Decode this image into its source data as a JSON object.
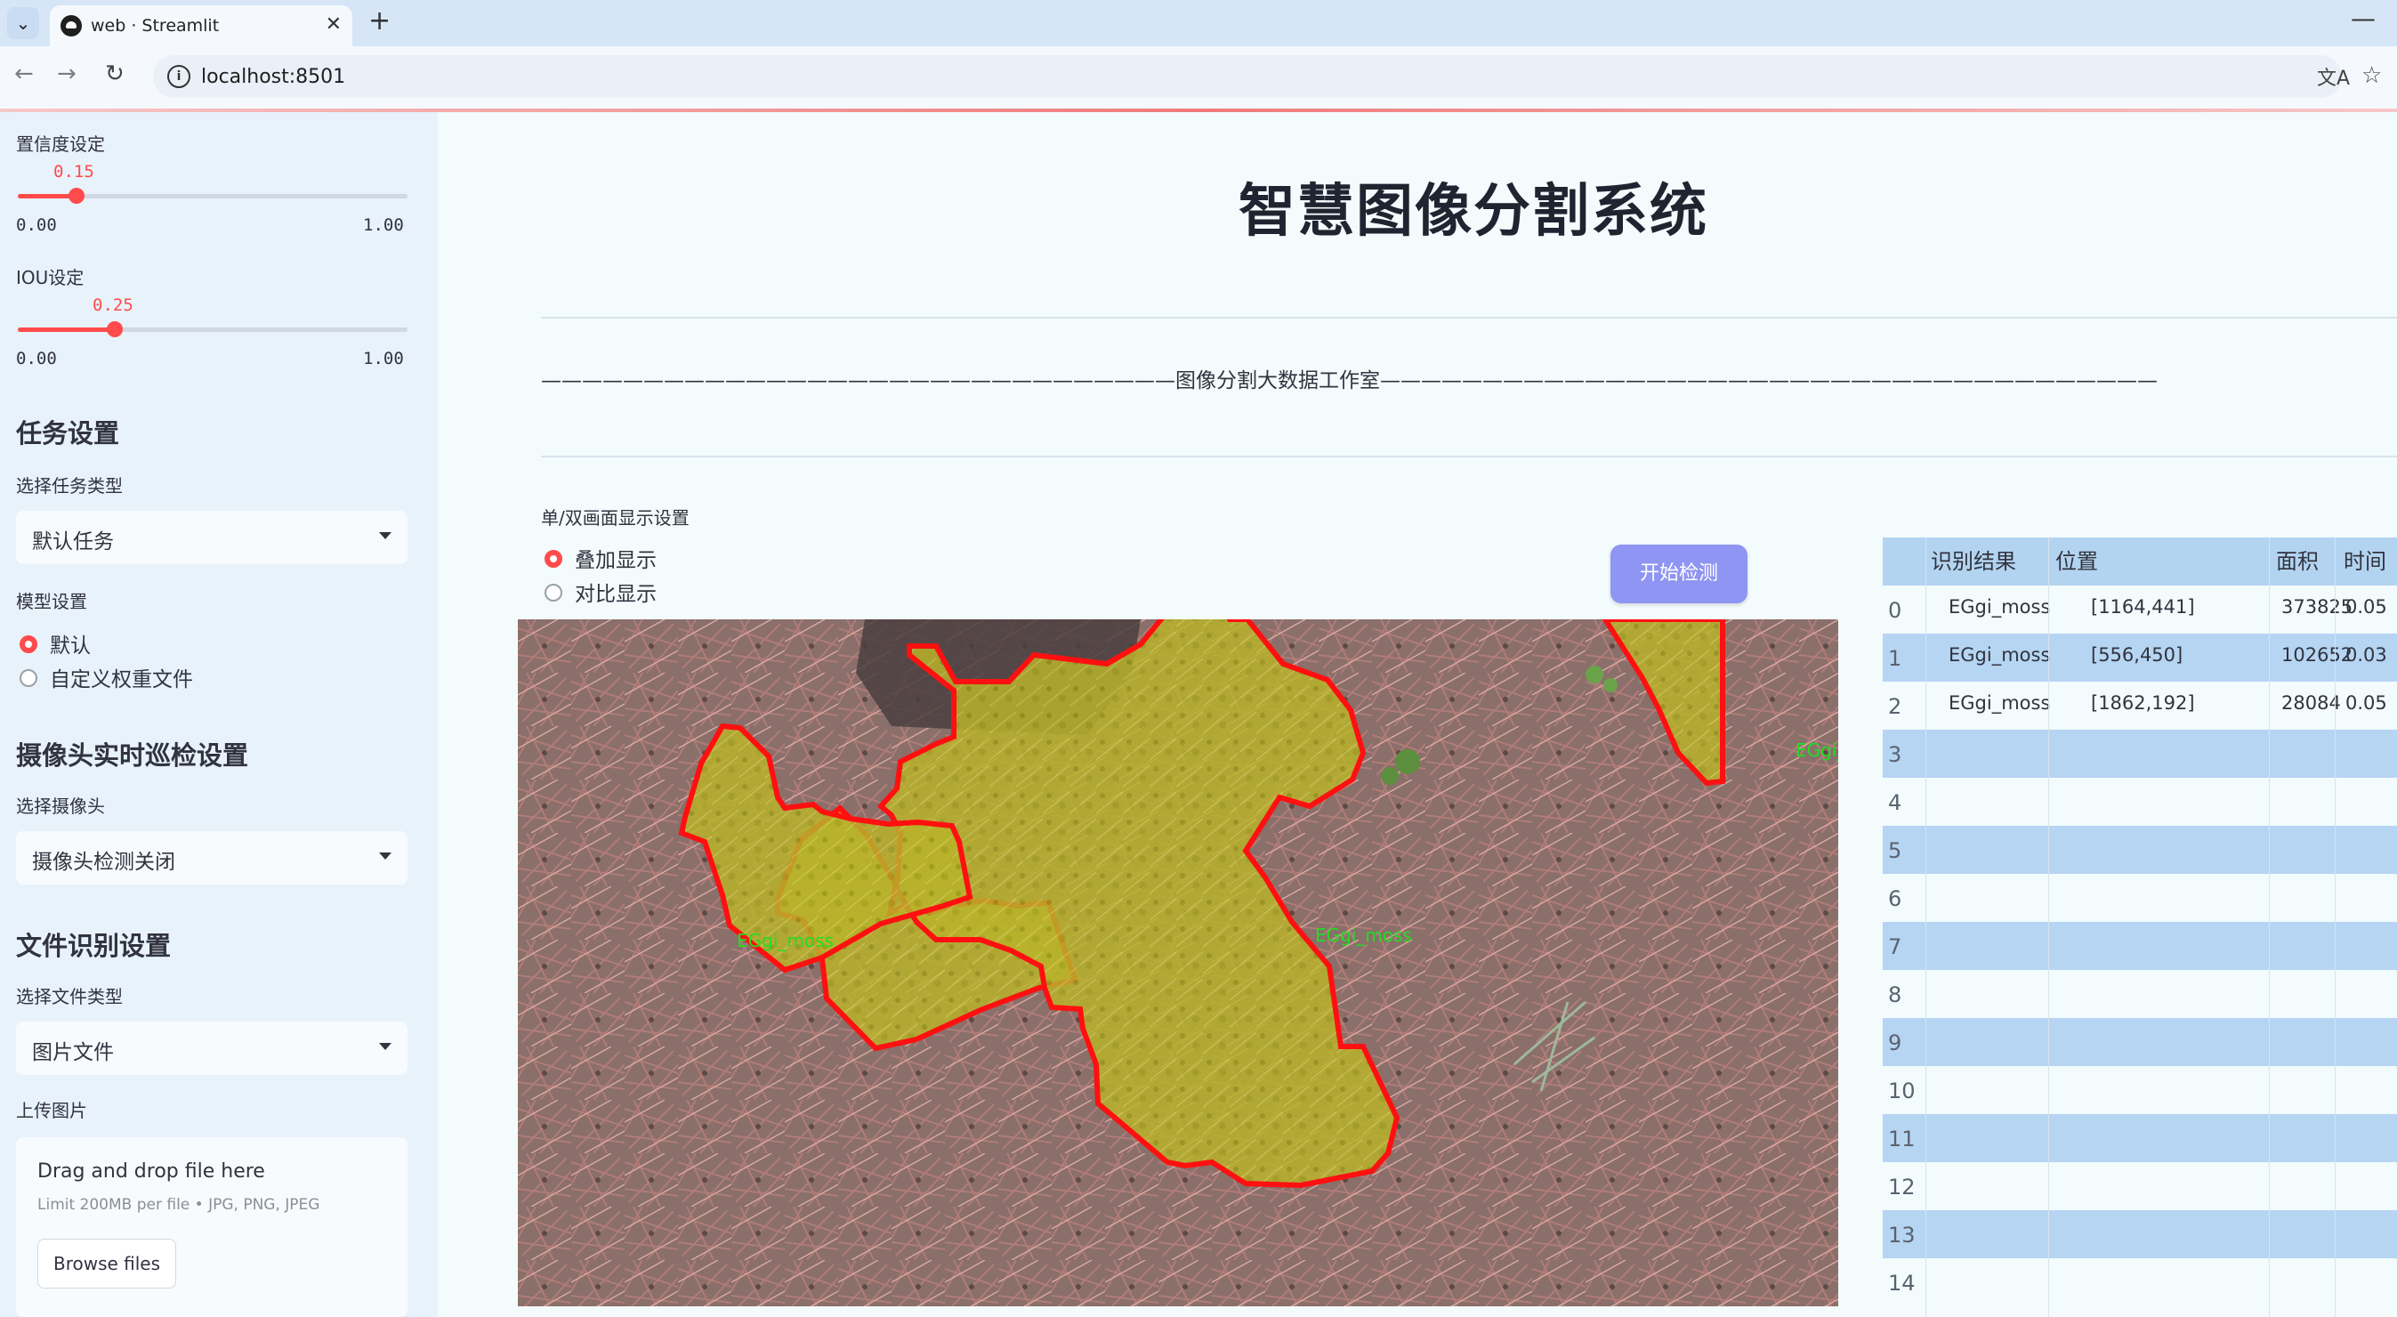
{
  "browser": {
    "tab_title": "web · Streamlit",
    "url": "localhost:8501"
  },
  "sidebar": {
    "confidence": {
      "label": "置信度设定",
      "value": "0.15",
      "value_num": 0.15,
      "min": "0.00",
      "max": "1.00"
    },
    "iou": {
      "label": "IOU设定",
      "value": "0.25",
      "value_num": 0.25,
      "min": "0.00",
      "max": "1.00"
    },
    "task": {
      "heading": "任务设置",
      "label": "选择任务类型",
      "selected": "默认任务"
    },
    "model": {
      "label": "模型设置",
      "options": [
        "默认",
        "自定义权重文件"
      ],
      "selected_index": 0
    },
    "camera": {
      "heading": "摄像头实时巡检设置",
      "label": "选择摄像头",
      "selected": "摄像头检测关闭"
    },
    "file": {
      "heading": "文件识别设置",
      "label": "选择文件类型",
      "selected": "图片文件"
    },
    "upload": {
      "label": "上传图片",
      "title": "Drag and drop file here",
      "limit": "Limit 200MB per file • JPG, PNG, JPEG",
      "button": "Browse files"
    }
  },
  "main": {
    "title": "智慧图像分割系统",
    "subtitle": "———————————————————————————————图像分割大数据工作室——————————————————————————————————————",
    "display": {
      "label": "单/双画面显示设置",
      "options": [
        "叠加显示",
        "对比显示"
      ],
      "selected_index": 0
    },
    "start_button": "开始检测",
    "image": {
      "detection_labels": [
        "EGgi_moss",
        "EGgi_moss",
        "EGgi_moss"
      ]
    },
    "table": {
      "columns": [
        "识别结果",
        "位置",
        "面积",
        "时间"
      ],
      "row_indices": [
        "0",
        "1",
        "2",
        "3",
        "4",
        "5",
        "6",
        "7",
        "8",
        "9",
        "10",
        "11",
        "12",
        "13",
        "14"
      ],
      "rows": [
        {
          "result": "EGgi_moss",
          "position": "[1164,441]",
          "area": "373825",
          "time": "0.05"
        },
        {
          "result": "EGgi_moss",
          "position": "[556,450]",
          "area": "102652",
          "time": "0.03"
        },
        {
          "result": "EGgi_moss",
          "position": "[1862,192]",
          "area": "28084",
          "time": "0.05"
        }
      ]
    }
  },
  "colors": {
    "accent": "#ff4b4b",
    "button": "#8f95f2",
    "table_header": "#b3d4f0",
    "table_alt_row": "#b5d5f2",
    "mask_fill": "#c8c400",
    "mask_outline": "#ff1010",
    "mask_label": "#22dd22"
  },
  "icons": [
    "chevron-down-icon",
    "close-icon",
    "plus-icon",
    "back-arrow-icon",
    "forward-arrow-icon",
    "reload-icon",
    "info-icon",
    "translate-icon",
    "star-icon",
    "minimize-icon"
  ]
}
